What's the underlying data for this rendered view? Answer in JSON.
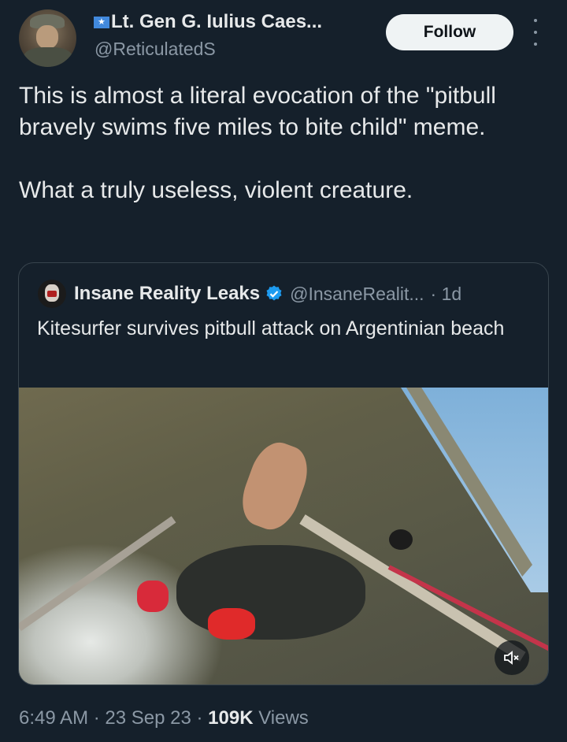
{
  "author": {
    "display_name": "Lt. Gen G. Iulius Caes...",
    "handle": "@ReticulatedS",
    "follow_label": "Follow"
  },
  "tweet": {
    "line1": "This is almost a literal evocation of the \"pitbull bravely swims five miles to bite child\" meme.",
    "line2": "What a truly useless, violent creature."
  },
  "quoted": {
    "name": "Insane Reality Leaks",
    "handle": "@InsaneRealit...",
    "age": "· 1d",
    "text": "Kitesurfer survives pitbull attack on Argentinian beach"
  },
  "meta": {
    "time": "6:49 AM",
    "sep1": " · ",
    "date": "23 Sep 23",
    "sep2": " · ",
    "views_count": "109K",
    "views_label": " Views"
  },
  "colors": {
    "background": "#15202b",
    "verified": "#1d9bf0"
  },
  "icons": [
    "somalia-flag-icon",
    "more-icon",
    "verified-icon",
    "mute-icon"
  ]
}
